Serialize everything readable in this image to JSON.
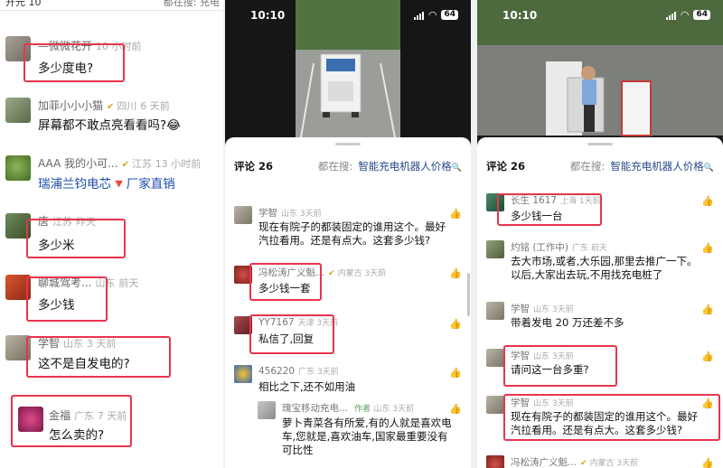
{
  "panel1": {
    "topbar": {
      "left": "开元 10",
      "right": "都在搜: 充电"
    },
    "comments": [
      {
        "name": "—微微花开",
        "time": "10 小时前",
        "text": "多少度电?"
      },
      {
        "name": "加菲小小小猫",
        "location": "四川",
        "time": "6 天前",
        "text": "屏幕都不敢点亮看看吗?😂"
      },
      {
        "name": "AAA 我的小可...",
        "location": "江苏",
        "time": "13 小时前",
        "text": "瑞浦兰钧电芯🔻厂家直销"
      },
      {
        "name": "唐",
        "location": "江苏",
        "time": "昨天",
        "text": "多少米"
      },
      {
        "name": "聊城驾考...",
        "location": "山东",
        "time": "前天",
        "text": "多少钱"
      },
      {
        "name": "学智",
        "location": "山东",
        "time": "3 天前",
        "text": "这不是自发电的?"
      },
      {
        "name": "金福",
        "location": "广东",
        "time": "7 天前",
        "text": "怎么卖的?"
      }
    ]
  },
  "status_bar": {
    "time": "10:10",
    "battery": "64"
  },
  "panel2": {
    "header": {
      "count_label": "评论 26",
      "search_label": "都在搜:",
      "search_keyword": "智能充电机器人价格"
    },
    "comments": [
      {
        "name": "学智",
        "location": "山东 3天前",
        "text": "现在有院子的都装固定的谁用这个。最好汽拉看用。还是有点大。这套多少钱?"
      },
      {
        "name": "冯松涛广义魁...",
        "location": "内蒙古 3天前",
        "text": "多少钱一套"
      },
      {
        "name": "YY7167",
        "location": "天津 3天前",
        "text": "私信了,回复"
      },
      {
        "name": "456220",
        "location": "广东 3天前",
        "text": "相比之下,还不如用油"
      },
      {
        "name": "瑰宝移动充电...",
        "author_tag": "作者",
        "location": "山东 3天前",
        "text": "萝卜青菜各有所爱,有的人就是喜欢电车,您就是,喜欢油车,国家最重要没有可比性"
      }
    ]
  },
  "panel3": {
    "header": {
      "count_label": "评论 26",
      "search_label": "都在搜:",
      "search_keyword": "智能充电机器人价格"
    },
    "comments": [
      {
        "name": "长生 1617",
        "location": "上海 1天前",
        "text": "多少钱一台"
      },
      {
        "name": "灼铭 (工作中)",
        "location": "广东 前天",
        "text": "去大市场,或者,大乐园,那里去推广一下。以后,大家出去玩,不用找充电桩了"
      },
      {
        "name": "学智",
        "location": "山东 3天前",
        "text": "带着发电 20 万还差不多"
      },
      {
        "name": "学智",
        "location": "山东 3天前",
        "text": "请问这一台多重?"
      },
      {
        "name": "学智",
        "location": "山东 3天前",
        "text": "现在有院子的都装固定的谁用这个。最好汽拉看用。还是有点大。这套多少钱?"
      },
      {
        "name": "冯松涛广义魁...",
        "location": "内蒙古 3天前",
        "text": ""
      }
    ]
  }
}
